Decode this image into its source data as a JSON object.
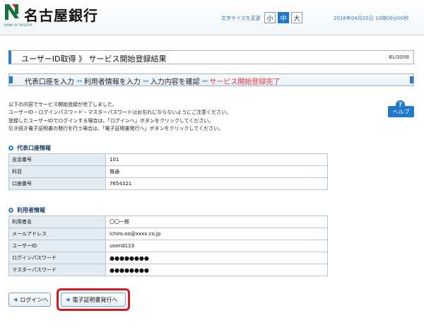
{
  "header": {
    "bank_name": "名古屋銀行",
    "logo_sub": "BANK OF NAGOYA",
    "font_size_label": "文字サイズを変更",
    "font_sizes": [
      "小",
      "中",
      "大"
    ],
    "datetime": "2016年04月20日 10時00分00秒",
    "colors": {
      "accent": "#1f79c8",
      "logo_green": "#1b6d3a",
      "highlight": "#e0141b"
    }
  },
  "title": {
    "text": "ユーザーID取得 》 サービス開始登録結果",
    "screen_id": "BLI3008"
  },
  "steps": [
    {
      "label": "代表口座を入力",
      "current": false
    },
    {
      "label": "利用者情報を入力",
      "current": false
    },
    {
      "label": "入力内容を確認",
      "current": false
    },
    {
      "label": "サービス開始登録完了",
      "current": true
    }
  ],
  "step_separator": "»»",
  "message": [
    "以下の内容でサービス開始登録が完了しました。",
    "ユーザーID・ログインパスワード・マスターパスワードはお忘れにならないようにご注意ください。",
    "登録したユーザーIDでログインする場合は、「ログインへ」ボタンをクリックしてください。",
    "引き続き電子証明書の発行を行う場合は、「電子証明書発行へ」ボタンをクリックしてください。"
  ],
  "help": {
    "icon": "?",
    "label": "ヘルプ"
  },
  "account_section": {
    "title": "代表口座情報",
    "rows": [
      {
        "label": "支店番号",
        "value": "101"
      },
      {
        "label": "科目",
        "value": "普通"
      },
      {
        "label": "口座番号",
        "value": "7654321"
      }
    ]
  },
  "user_section": {
    "title": "利用者情報",
    "rows": [
      {
        "label": "利用者名",
        "value": "〇〇一郎"
      },
      {
        "label": "メールアドレス",
        "value": "ichiro.oo@xxxx.co.jp"
      },
      {
        "label": "ユーザーID",
        "value": "userid123"
      },
      {
        "label": "ログインパスワード",
        "value": "●●●●●●●●"
      },
      {
        "label": "マスターパスワード",
        "value": "●●●●●●●●"
      }
    ]
  },
  "buttons": {
    "login": "ログインへ",
    "certificate": "電子証明書発行へ"
  }
}
